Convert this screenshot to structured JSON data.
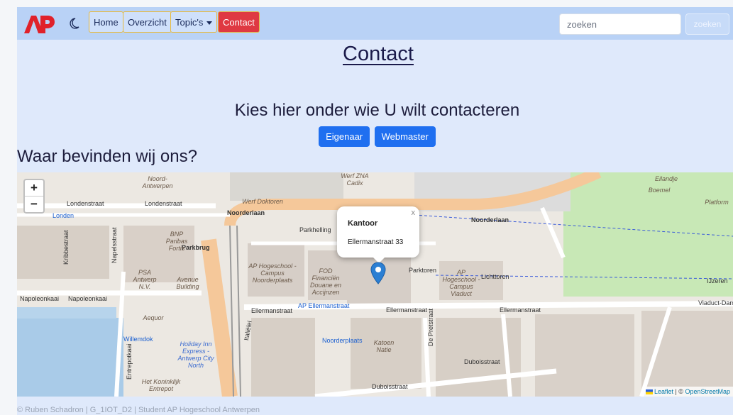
{
  "nav": {
    "logo_text": "AP",
    "items": [
      {
        "label": "Home"
      },
      {
        "label": "Overzicht"
      },
      {
        "label": "Topic's"
      },
      {
        "label": "Contact"
      }
    ],
    "search_placeholder": "zoeken",
    "search_button": "zoeken"
  },
  "page_title": "Contact",
  "contact": {
    "heading": "Kies hier onder wie U wilt contacteren",
    "buttons": [
      {
        "label": "Eigenaar"
      },
      {
        "label": "Webmaster"
      }
    ]
  },
  "location_heading": "Waar bevinden wij ons?",
  "map": {
    "zoom_in": "+",
    "zoom_out": "−",
    "popup": {
      "title": "Kantoor",
      "address": "Ellermanstraat 33",
      "close": "x"
    },
    "streets": {
      "londenstraat": "Londenstraat",
      "londen": "Londen",
      "noorderlaan": "Noorderlaan",
      "parkhelling": "Parkhelling",
      "parkbrug": "Parkbrug",
      "napoleonkaai": "Napoleonkaai",
      "ellermanstraat": "Ellermanstraat",
      "ap_ellermanstraat": "AP Ellermanstraat",
      "duboisstraat": "Duboisstraat",
      "de_pretstraat": "De Pretstraat",
      "viaduct_dam": "Viaduct-Dam",
      "ijzeren": "IJzeren",
      "kribbestraat": "Kribbestraat",
      "napelsstraat": "Napelsstraat",
      "entrepotkaai": "Entrepotkaai",
      "willemdok": "Willemdok",
      "noorderplaats": "Noorderplaats",
      "parktoren": "Parktoren",
      "lichttoren": "Lichttoren",
      "italielei": "Italiëlei"
    },
    "places": {
      "ap_noorderplaats": "AP Hogeschool - Campus Noorderplaats",
      "ap_viaduct": "AP Hogeschool - Campus Viaduct",
      "fod": "FOD Financiën Douane en Accijnzen",
      "bnp": "BNP Paribas Fortis",
      "katoen": "Katoen Natie",
      "psa": "PSA Antwerp N.V.",
      "avenue": "Avenue Building",
      "holiday": "Holiday Inn Express - Antwerp City North",
      "werf_doktoren": "Werf Doktoren",
      "werf_cadix": "Werf ZNA Cadix",
      "eilandje": "Eilandje",
      "boemel": "Boemel",
      "platform": "Platform",
      "aequor": "Aequor",
      "noord": "Noord-Antwerpen",
      "entrepot": "Het Koninklijk Entrepot"
    },
    "attribution_leaflet": "Leaflet",
    "attribution_sep": " | © ",
    "attribution_osm": "OpenStreetMap"
  },
  "footer": "© Ruben Schadron | G_1IOT_D2 | Student AP Hogeschool Antwerpen",
  "colors": {
    "navbar": "#b9d2f6",
    "contact_active": "#df3942",
    "primary": "#1f6ff0",
    "logo_red": "#e0212a"
  }
}
